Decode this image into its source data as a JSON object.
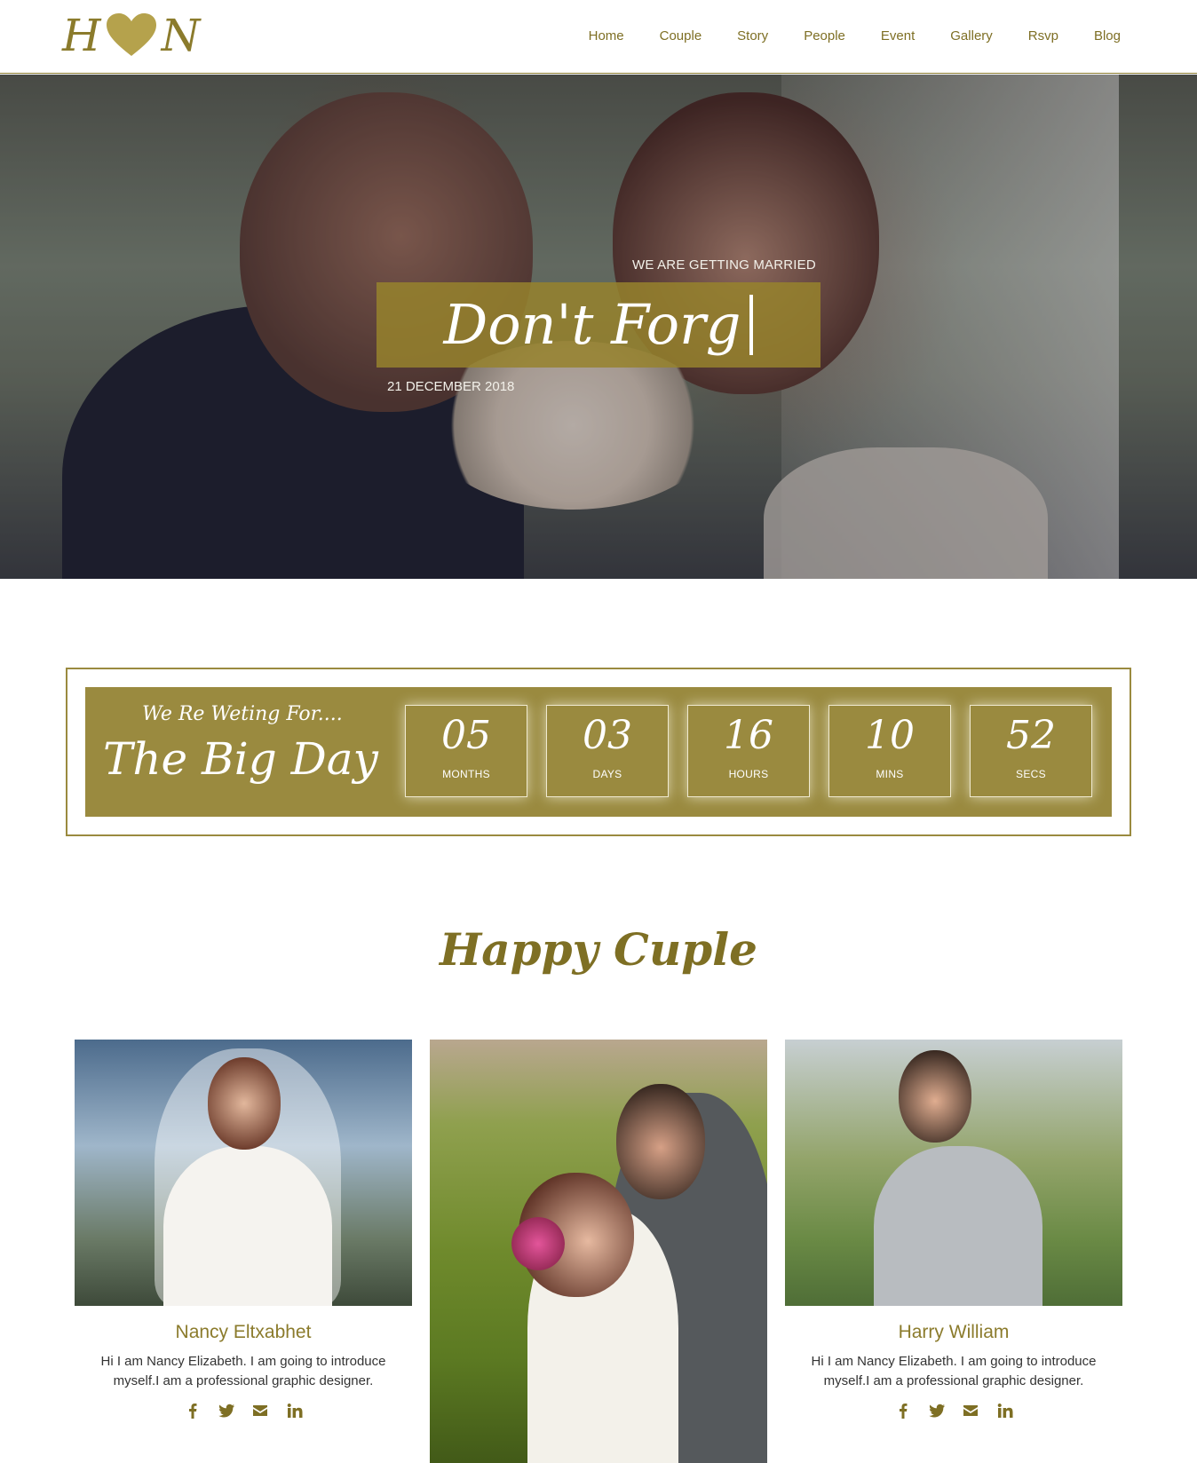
{
  "header": {
    "logo": {
      "left_letter": "H",
      "right_letter": "N",
      "icon": "heart-icon"
    },
    "nav": [
      "Home",
      "Couple",
      "Story",
      "People",
      "Event",
      "Gallery",
      "Rsvp",
      "Blog"
    ]
  },
  "hero": {
    "kicker": "WE ARE GETTING MARRIED",
    "title": "Don't Forg",
    "date": "21 DECEMBER 2018"
  },
  "countdown": {
    "kicker": "We Re Weting For....",
    "title": "The Big Day",
    "units": [
      {
        "value": "05",
        "label": "MONTHS"
      },
      {
        "value": "03",
        "label": "DAYS"
      },
      {
        "value": "16",
        "label": "HOURS"
      },
      {
        "value": "10",
        "label": "MINS"
      },
      {
        "value": "52",
        "label": "SECS"
      }
    ]
  },
  "couple": {
    "title": "Happy Cuple",
    "bride": {
      "name": "Nancy Eltxabhet",
      "bio": "Hi I am Nancy Elizabeth. I am going to introduce myself.I am a professional graphic designer."
    },
    "groom": {
      "name": "Harry William",
      "bio": "Hi I am Nancy Elizabeth. I am going to introduce myself.I am a professional graphic designer."
    },
    "socials": [
      "facebook-icon",
      "twitter-icon",
      "envelope-icon",
      "linkedin-icon"
    ]
  },
  "colors": {
    "accent": "#9a8a3f",
    "accent_text": "#7e6f24",
    "white": "#ffffff"
  }
}
